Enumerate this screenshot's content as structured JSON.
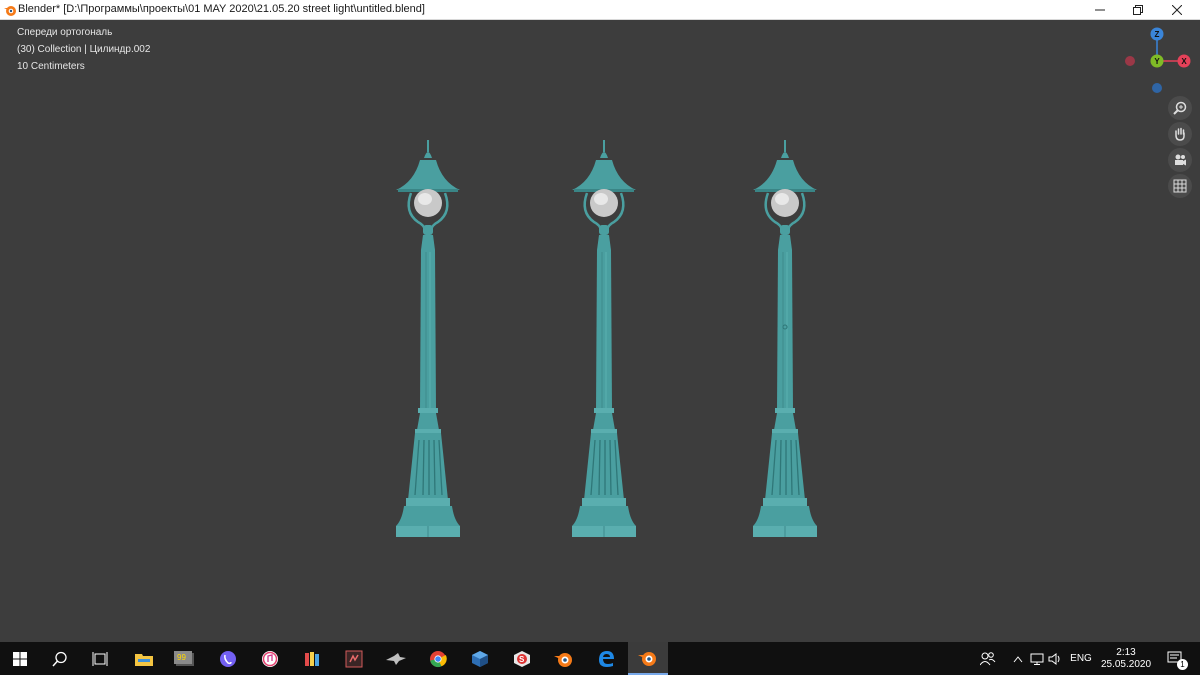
{
  "window": {
    "title": "Blender* [D:\\Программы\\проекты\\01 MAY 2020\\21.05.20 street light\\untitled.blend]"
  },
  "viewport": {
    "view_name": "Спереди ортогональ",
    "collection_info": "(30) Collection | Цилиндр.002",
    "scale_info": "10 Centimeters",
    "model_color": "#4a9fa0",
    "background_color": "#3d3d3d"
  },
  "gizmo": {
    "z_label": "Z",
    "y_label": "Y",
    "x_label": "X",
    "x_color": "#e54159",
    "y_color": "#7fbb26",
    "z_color": "#3a85d9"
  },
  "nav_tools": [
    {
      "name": "zoom-icon"
    },
    {
      "name": "hand-pan-icon"
    },
    {
      "name": "camera-icon"
    },
    {
      "name": "grid-toggle-icon"
    }
  ],
  "taskbar": {
    "apps": [
      "windows-start-icon",
      "search-icon",
      "task-view-icon",
      "file-explorer-icon",
      "app-99-icon",
      "viber-icon",
      "itunes-icon",
      "app-books-icon",
      "app-puzzle-icon",
      "app-eagle-icon",
      "chrome-icon",
      "app-3d-icon",
      "app-s-icon",
      "blender-icon",
      "edge-icon",
      "blender-active-icon"
    ],
    "language": "ENG",
    "time": "2:13",
    "date": "25.05.2020",
    "notification_count": "1"
  }
}
